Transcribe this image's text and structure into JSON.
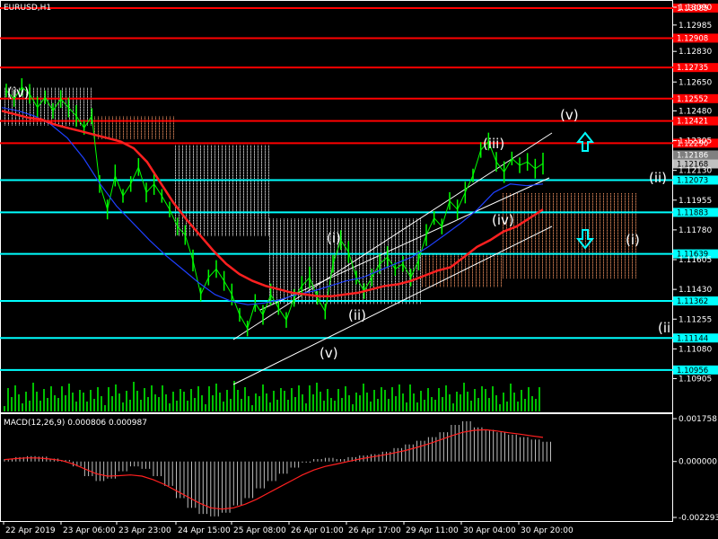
{
  "header": {
    "symbol_label": "EURUSD,H1"
  },
  "chart_data": [
    {
      "type": "line",
      "title": "EURUSD,H1",
      "ylim": [
        1.1086,
        1.1309
      ],
      "x_ticks": [
        "22 Apr 2019",
        "23 Apr 06:00",
        "23 Apr 23:00",
        "24 Apr 15:00",
        "25 Apr 08:00",
        "26 Apr 01:00",
        "26 Apr 17:00",
        "29 Apr 11:00",
        "30 Apr 04:00",
        "30 Apr 20:00"
      ],
      "y_ticks": [
        "1.13090",
        "1.12985",
        "1.12830",
        "1.12650",
        "1.12480",
        "1.12305",
        "1.12130",
        "1.11955",
        "1.11780",
        "1.11605",
        "1.11430",
        "1.11255",
        "1.11080",
        "1.10905"
      ],
      "current_price": "1.12168",
      "current_price_secondary": "1.12186",
      "horizontal_levels": [
        {
          "value": 1.13085,
          "label": "1.13085",
          "color": "#ff0000"
        },
        {
          "value": 1.12908,
          "label": "1.12908",
          "color": "#ff0000"
        },
        {
          "value": 1.12735,
          "label": "1.12735",
          "color": "#ff0000"
        },
        {
          "value": 1.12552,
          "label": "1.12552",
          "color": "#ff0000"
        },
        {
          "value": 1.12421,
          "label": "1.12421",
          "color": "#ff0000"
        },
        {
          "value": 1.1229,
          "label": "1.12290",
          "color": "#ff0000"
        },
        {
          "value": 1.12073,
          "label": "1.12073",
          "color": "#00ffff"
        },
        {
          "value": 1.11883,
          "label": "1.11883",
          "color": "#00ffff"
        },
        {
          "value": 1.11639,
          "label": "1.11639",
          "color": "#00ffff"
        },
        {
          "value": 1.11362,
          "label": "1.11362",
          "color": "#00ffff"
        },
        {
          "value": 1.11144,
          "label": "1.11144",
          "color": "#00ffff"
        },
        {
          "value": 1.10956,
          "label": "1.10956",
          "color": "#00ffff"
        }
      ],
      "price": [
        1.126,
        1.1255,
        1.1262,
        1.1258,
        1.125,
        1.1256,
        1.1248,
        1.1255,
        1.125,
        1.1245,
        1.1238,
        1.1245,
        1.1205,
        1.119,
        1.121,
        1.1198,
        1.1205,
        1.1215,
        1.12,
        1.1205,
        1.1198,
        1.119,
        1.118,
        1.1175,
        1.116,
        1.114,
        1.115,
        1.1155,
        1.1148,
        1.114,
        1.1128,
        1.112,
        1.1135,
        1.1128,
        1.114,
        1.1132,
        1.1125,
        1.1138,
        1.1145,
        1.115,
        1.1138,
        1.113,
        1.1158,
        1.1172,
        1.1165,
        1.115,
        1.1142,
        1.115,
        1.1158,
        1.1162,
        1.1155,
        1.1158,
        1.115,
        1.116,
        1.1175,
        1.1185,
        1.118,
        1.1195,
        1.119,
        1.12,
        1.121,
        1.1225,
        1.123,
        1.1218,
        1.1212,
        1.122,
        1.1216,
        1.1218,
        1.1214,
        1.1217
      ],
      "ma_red": [
        1.1248,
        1.1246,
        1.1244,
        1.1243,
        1.124,
        1.1238,
        1.1236,
        1.1234,
        1.1232,
        1.123,
        1.1226,
        1.1218,
        1.1206,
        1.1194,
        1.1184,
        1.1175,
        1.1166,
        1.1158,
        1.1152,
        1.1148,
        1.1145,
        1.1143,
        1.1141,
        1.114,
        1.1139,
        1.1139,
        1.114,
        1.1141,
        1.1143,
        1.1145,
        1.1146,
        1.1148,
        1.1151,
        1.1154,
        1.1156,
        1.1162,
        1.1168,
        1.1172,
        1.1177,
        1.118,
        1.1185,
        1.119
      ],
      "ma_blue": [
        1.125,
        1.1248,
        1.1245,
        1.124,
        1.1232,
        1.122,
        1.1205,
        1.1192,
        1.1182,
        1.1172,
        1.1163,
        1.1155,
        1.1147,
        1.114,
        1.1136,
        1.1134,
        1.1135,
        1.1137,
        1.114,
        1.1142,
        1.1145,
        1.1148,
        1.115,
        1.1154,
        1.1158,
        1.1162,
        1.1168,
        1.1175,
        1.1182,
        1.119,
        1.12,
        1.1205,
        1.1204,
        1.1205
      ],
      "ichimoku_cloud": {
        "color_up": "#ffffff",
        "color_down": "#ff9a66"
      },
      "channel": {
        "color": "#ffffff"
      },
      "wave_labels": [
        "(iv)",
        "(v)",
        "(i)",
        "(ii)",
        "(iii)",
        "(iv)",
        "(v)",
        "(ii)",
        "(i)",
        "(ii"
      ],
      "arrows": [
        {
          "direction": "up",
          "color": "#00ffff"
        },
        {
          "direction": "down",
          "color": "#00ffff"
        }
      ],
      "volume": "bars"
    },
    {
      "type": "bar",
      "title": "MACD(12,26,9) 0.000806 0.000987",
      "ylim": [
        -0.002293,
        0.001758
      ],
      "y_ticks": [
        "0.001758",
        "0.000000",
        "-0.002293"
      ],
      "histogram": [
        0.0001,
        0.00018,
        0.00022,
        0.0002,
        0.00012,
        6e-05,
        -0.0002,
        -0.0006,
        -0.0008,
        -0.0007,
        -0.0004,
        -0.0002,
        -0.0003,
        -0.0006,
        -0.001,
        -0.0015,
        -0.0019,
        -0.00215,
        -0.00225,
        -0.0021,
        -0.0018,
        -0.0015,
        -0.0011,
        -0.0008,
        -0.0005,
        -0.00025,
        -5e-05,
        0.0001,
        0.00015,
        0.0001,
        0.00018,
        0.00025,
        0.0003,
        0.0004,
        0.00055,
        0.0007,
        0.00085,
        0.001,
        0.0012,
        0.0015,
        0.00165,
        0.0014,
        0.0013,
        0.0012,
        0.0011,
        0.001,
        0.0009,
        0.00081
      ],
      "signal": [
        8e-05,
        0.00012,
        0.00015,
        0.00014,
        0.0001,
        4e-05,
        -0.0001,
        -0.0003,
        -0.0005,
        -0.0006,
        -0.00058,
        -0.00055,
        -0.0006,
        -0.00075,
        -0.00095,
        -0.0012,
        -0.00145,
        -0.0017,
        -0.0019,
        -0.00195,
        -0.0019,
        -0.00175,
        -0.00155,
        -0.0013,
        -0.00105,
        -0.0008,
        -0.00055,
        -0.00035,
        -0.0002,
        -0.0001,
        0.0,
        0.0001,
        0.00018,
        0.00026,
        0.00035,
        0.00045,
        0.00058,
        0.00072,
        0.00088,
        0.00105,
        0.0012,
        0.00128,
        0.0013,
        0.00125,
        0.00118,
        0.00112,
        0.00105,
        0.00099
      ]
    }
  ]
}
